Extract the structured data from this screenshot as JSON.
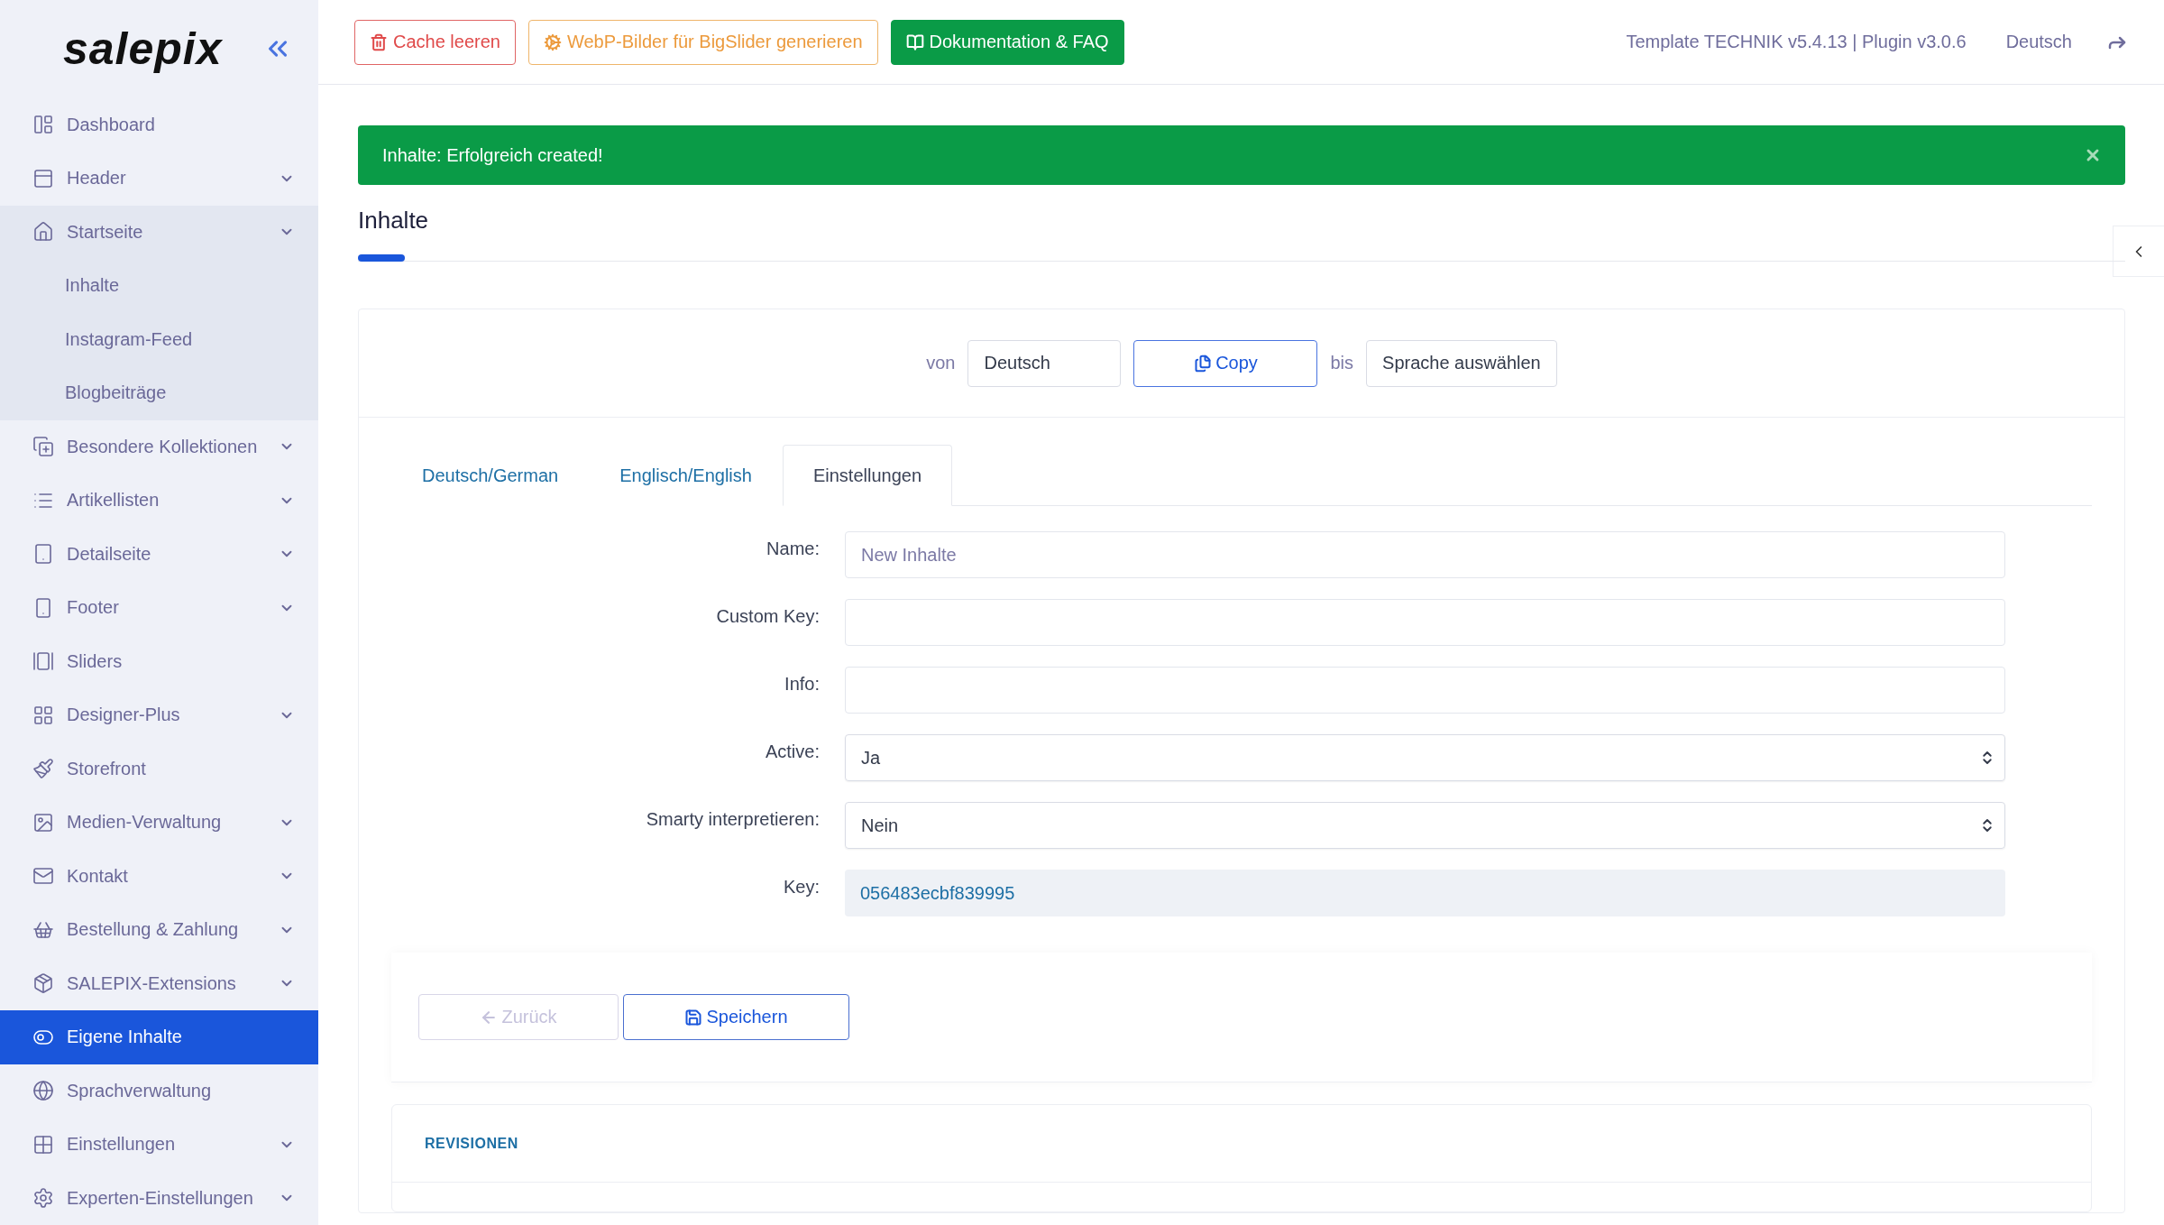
{
  "sidebar": {
    "logo": "salepix",
    "items": [
      {
        "label": "Dashboard",
        "submenu": false,
        "selected": false
      },
      {
        "label": "Header",
        "submenu": true,
        "selected": false
      },
      {
        "label": "Startseite",
        "submenu": true,
        "selected": false,
        "children": [
          {
            "label": "Inhalte"
          },
          {
            "label": "Instagram-Feed"
          },
          {
            "label": "Blogbeiträge"
          }
        ]
      },
      {
        "label": "Besondere Kollektionen",
        "submenu": true,
        "selected": false
      },
      {
        "label": "Artikellisten",
        "submenu": true,
        "selected": false
      },
      {
        "label": "Detailseite",
        "submenu": true,
        "selected": false
      },
      {
        "label": "Footer",
        "submenu": true,
        "selected": false
      },
      {
        "label": "Sliders",
        "submenu": false,
        "selected": false
      },
      {
        "label": "Designer-Plus",
        "submenu": true,
        "selected": false
      },
      {
        "label": "Storefront",
        "submenu": false,
        "selected": false
      },
      {
        "label": "Medien-Verwaltung",
        "submenu": true,
        "selected": false
      },
      {
        "label": "Kontakt",
        "submenu": true,
        "selected": false
      },
      {
        "label": "Bestellung & Zahlung",
        "submenu": true,
        "selected": false
      },
      {
        "label": "SALEPIX-Extensions",
        "submenu": true,
        "selected": false
      },
      {
        "label": "Eigene Inhalte",
        "submenu": false,
        "selected": true
      },
      {
        "label": "Sprachverwaltung",
        "submenu": false,
        "selected": false
      },
      {
        "label": "Einstellungen",
        "submenu": true,
        "selected": false
      },
      {
        "label": "Experten-Einstellungen",
        "submenu": true,
        "selected": false
      }
    ]
  },
  "toolbar": {
    "buttons": [
      {
        "label": "Cache leeren",
        "kind": "danger"
      },
      {
        "label": "WebP-Bilder für BigSlider generieren",
        "kind": "warning"
      },
      {
        "label": "Dokumentation & FAQ",
        "kind": "success"
      }
    ],
    "version": "Template TECHNIK v5.4.13 | Plugin v3.0.6",
    "language": "Deutsch"
  },
  "alert": {
    "message": "Inhalte: Erfolgreich created!"
  },
  "page_title": "Inhalte",
  "copy_bar": {
    "from_label": "von",
    "from_value": "Deutsch",
    "copy_button": "Copy",
    "to_label": "bis",
    "to_value": "Sprache auswählen"
  },
  "tabs": [
    {
      "label": "Deutsch/German",
      "selected": false
    },
    {
      "label": "Englisch/English",
      "selected": false
    },
    {
      "label": "Einstellungen",
      "selected": true
    }
  ],
  "fields": [
    {
      "label": "Name:",
      "kind": "text",
      "placeholder": "New Inhalte"
    },
    {
      "label": "Custom Key:",
      "kind": "text"
    },
    {
      "label": "Info:",
      "kind": "text"
    },
    {
      "label": "Active:",
      "kind": "select",
      "value": "Ja"
    },
    {
      "label": "Smarty interpretieren:",
      "kind": "select",
      "value": "Nein"
    },
    {
      "label": "Key:",
      "kind": "readonly",
      "value": "056483ecbf839995"
    }
  ],
  "actions": [
    {
      "label": "Zurück",
      "kind": "back",
      "disabled": true
    },
    {
      "label": "Speichern",
      "kind": "save",
      "disabled": false
    }
  ],
  "revisions": {
    "title": "REVISIONEN"
  }
}
